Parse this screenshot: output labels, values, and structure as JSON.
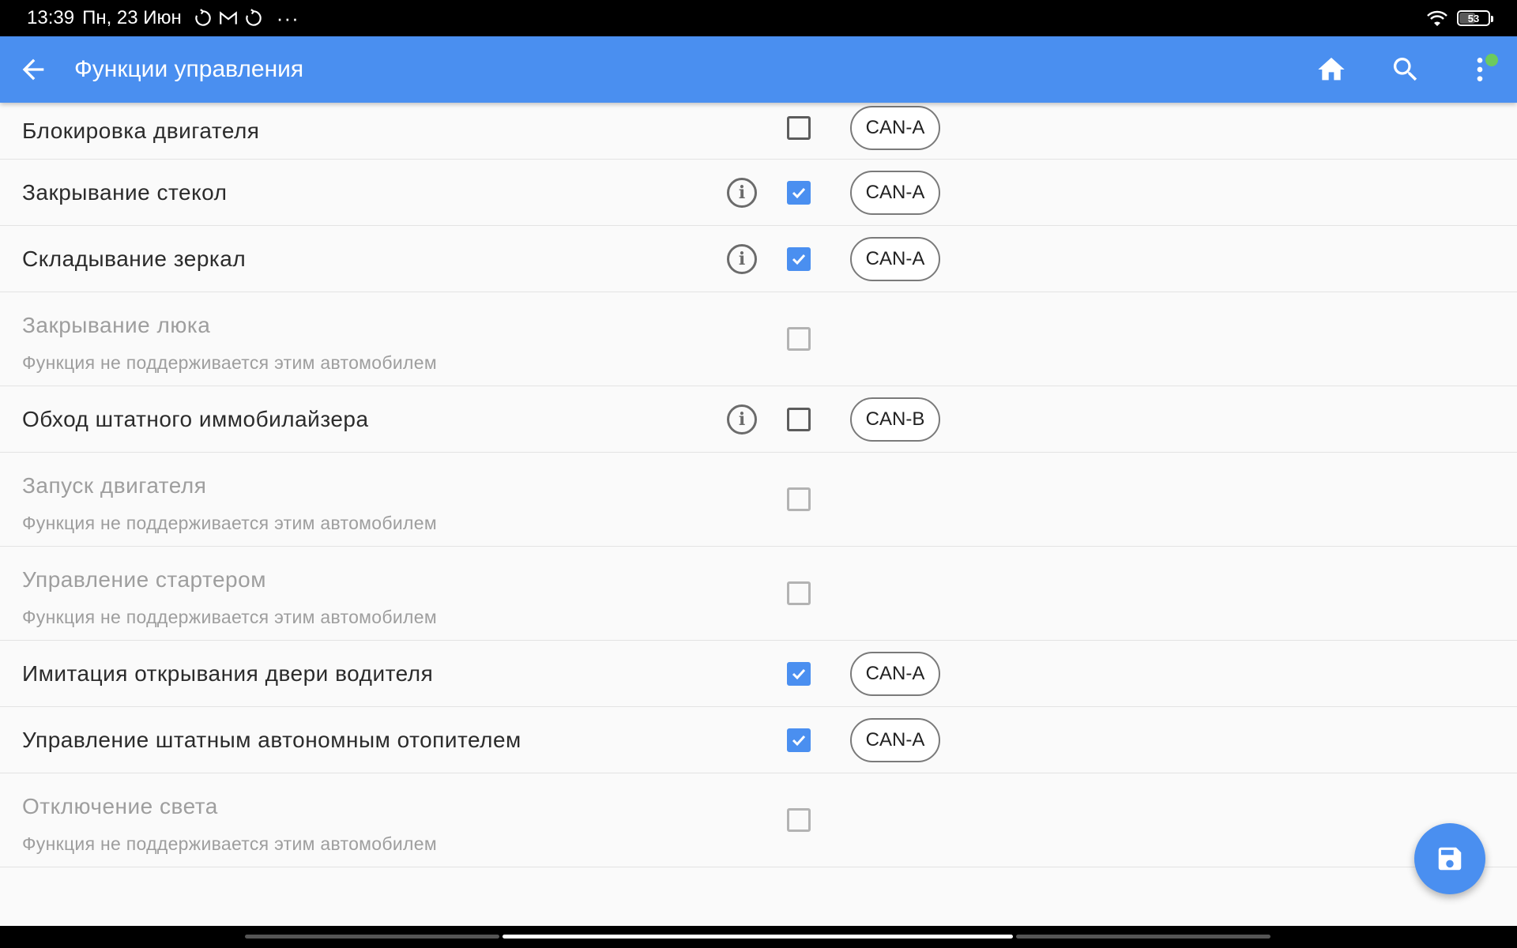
{
  "status_bar": {
    "time": "13:39",
    "date": "Пн, 23 Июн",
    "overflow": "···",
    "battery_level": "53",
    "icons": [
      "sync-icon",
      "gmail-icon",
      "sync-icon",
      "wifi-icon",
      "battery-icon"
    ]
  },
  "app_bar": {
    "title": "Функции управления",
    "icons": [
      "back-arrow-icon",
      "home-icon",
      "search-icon",
      "more-vert-icon"
    ],
    "accent": "#4a8ff0"
  },
  "list": {
    "items": [
      {
        "label": "Блокировка двигателя",
        "checked": false,
        "enabled": true,
        "info": false,
        "bus": "CAN-A"
      },
      {
        "label": "Закрывание стекол",
        "checked": true,
        "enabled": true,
        "info": true,
        "bus": "CAN-A"
      },
      {
        "label": "Складывание зеркал",
        "checked": true,
        "enabled": true,
        "info": true,
        "bus": "CAN-A"
      },
      {
        "label": "Закрывание люка",
        "sub": "Функция не поддерживается этим автомобилем",
        "checked": false,
        "enabled": false,
        "info": false
      },
      {
        "label": "Обход штатного иммобилайзера",
        "checked": false,
        "enabled": true,
        "info": true,
        "bus": "CAN-B"
      },
      {
        "label": "Запуск двигателя",
        "sub": "Функция не поддерживается этим автомобилем",
        "checked": false,
        "enabled": false,
        "info": false
      },
      {
        "label": "Управление стартером",
        "sub": "Функция не поддерживается этим автомобилем",
        "checked": false,
        "enabled": false,
        "info": false
      },
      {
        "label": "Имитация открывания двери водителя",
        "checked": true,
        "enabled": true,
        "info": false,
        "bus": "CAN-A"
      },
      {
        "label": "Управление штатным автономным отопителем",
        "checked": true,
        "enabled": true,
        "info": false,
        "bus": "CAN-A"
      },
      {
        "label": "Отключение света",
        "sub": "Функция не поддерживается этим автомобилем",
        "checked": false,
        "enabled": false,
        "info": false
      }
    ]
  },
  "fab": {
    "icon": "save-icon"
  },
  "info_glyph": "i"
}
